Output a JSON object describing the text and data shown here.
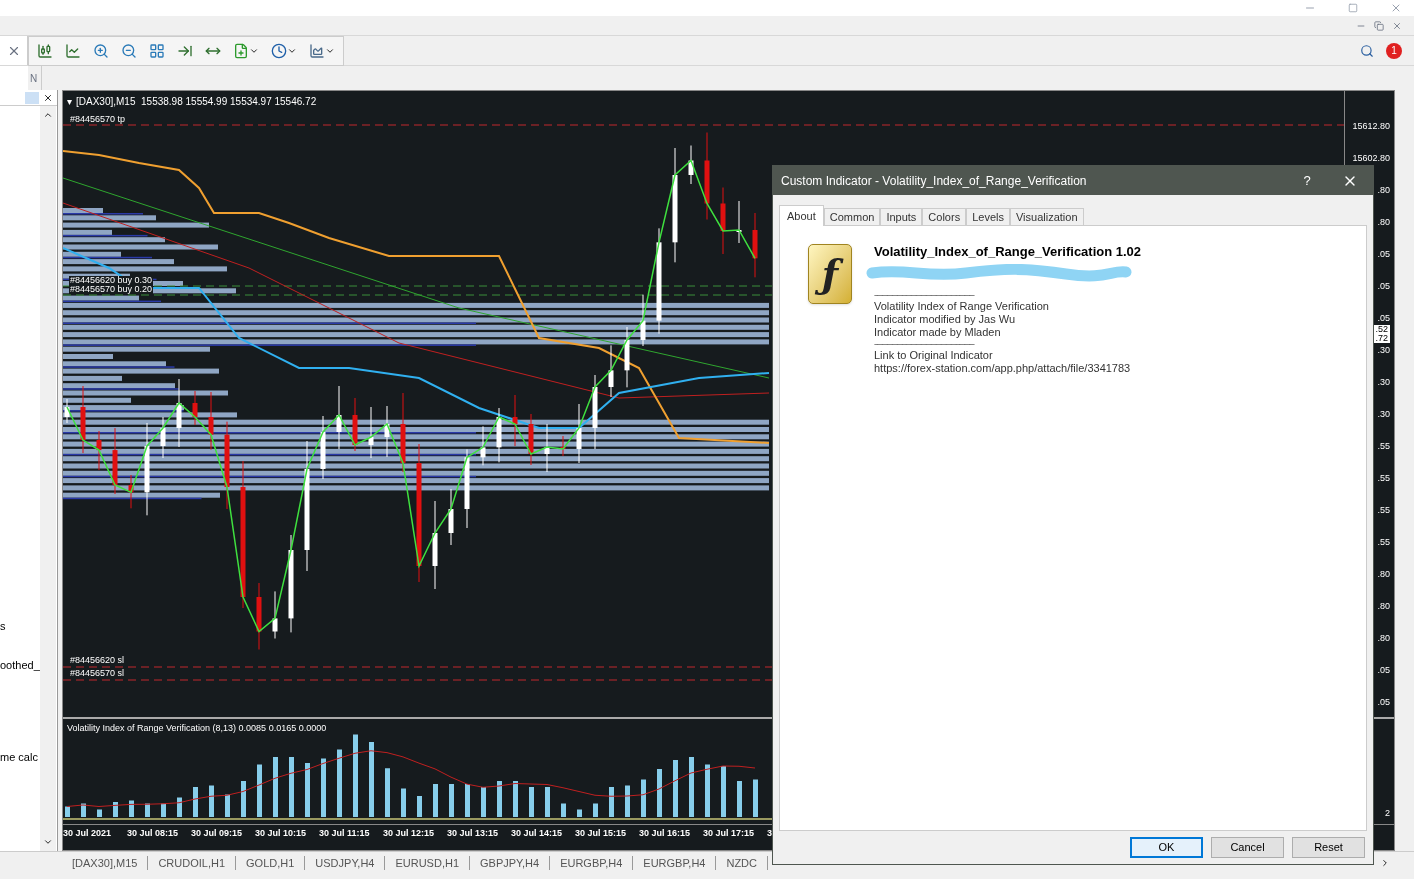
{
  "app_bar": {
    "notification_count": "1"
  },
  "navigator": {
    "header_letter": "N",
    "items": [
      "s",
      "oothed_",
      "me calc"
    ]
  },
  "chart": {
    "collapse_glyph": "▾",
    "header": "[DAX30],M15  15538.98 15554.99 15534.97 15546.72",
    "order_labels": [
      "#84456570 tp",
      "#84456620 buy 0.30",
      "#84456570 buy 0.20",
      "#84456620 sl",
      "#84456570 sl"
    ],
    "price_axis": [
      "15612.80",
      "15602.80",
      ".80",
      ".80",
      ".05",
      ".05",
      ".05",
      ".30",
      ".30",
      ".30",
      ".55",
      ".55",
      ".55",
      ".55",
      ".80",
      ".80",
      ".80",
      ".05",
      ".05"
    ],
    "price_marker": [
      ".52",
      ".72"
    ],
    "indicator": {
      "title": "Volatility Index of Range Verification (8,13) 0.0085 0.0165 0.0000",
      "axis_label": "2"
    },
    "time_axis": [
      "30 Jul 2021",
      "30 Jul 08:15",
      "30 Jul 09:15",
      "30 Jul 10:15",
      "30 Jul 11:15",
      "30 Jul 12:15",
      "30 Jul 13:15",
      "30 Jul 14:15",
      "30 Jul 15:15",
      "30 Jul 16:15",
      "30 Jul 17:15",
      "3"
    ]
  },
  "symbol_tabs": [
    "[DAX30],M15",
    "CRUDOIL,H1",
    "GOLD,H1",
    "USDJPY,H4",
    "EURUSD,H1",
    "GBPJPY,H4",
    "EURGBP,H4",
    "EURGBP,H4",
    "NZDC"
  ],
  "dialog": {
    "title": "Custom Indicator - Volatility_Index_of_Range_Verification",
    "help": "?",
    "icon_letter": "ƒ",
    "tabs": [
      {
        "label": "About",
        "selected": true
      },
      {
        "label": "Common",
        "selected": false
      },
      {
        "label": "Inputs",
        "selected": false
      },
      {
        "label": "Colors",
        "selected": false
      },
      {
        "label": "Levels",
        "selected": false
      },
      {
        "label": "Visualization",
        "selected": false
      }
    ],
    "indicator_name": "Volatility_Index_of_Range_Verification 1.02",
    "separator": "------------------------------------------------------------",
    "description": [
      "Volatility Index of Range Verification",
      "Indicator modified by Jas Wu",
      "Indicator made by Mladen"
    ],
    "separator_2": "------------------------------------------------------------",
    "link_label": "Link to Original Indicator",
    "link_url": "https://forex-station.com/app.php/attach/file/3341783",
    "buttons": [
      {
        "label": "OK",
        "default": true
      },
      {
        "label": "Cancel",
        "default": false
      },
      {
        "label": "Reset",
        "default": false
      }
    ]
  }
}
